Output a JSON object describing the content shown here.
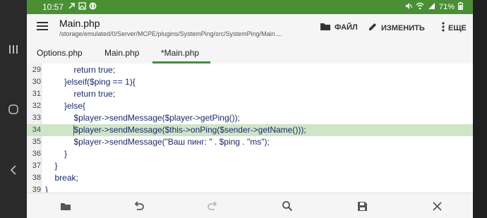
{
  "status": {
    "time": "10:57",
    "battery": "71%",
    "left_icons": [
      "missed-call-icon",
      "image-icon",
      "shazam-icon"
    ],
    "right_icons": [
      "mute-icon",
      "wifi-icon",
      "signal-icon",
      "battery-icon"
    ]
  },
  "toolbar": {
    "title": "Main.php",
    "path": "/storage/emulated/0/Server/MCPE/plugins/SystemPing/src/SystemPing/Main....",
    "file_label": "ФАЙЛ",
    "edit_label": "ИЗМЕНИТЬ",
    "more_label": "ЕЩЕ"
  },
  "tabs": [
    {
      "label": "Options.php",
      "active": false
    },
    {
      "label": "Main.php",
      "active": false
    },
    {
      "label": "*Main.php",
      "active": true
    }
  ],
  "editor": {
    "highlight_color": "#cfe5c8",
    "lines": [
      {
        "n": "29",
        "text": "return true;",
        "indent": 3
      },
      {
        "n": "30",
        "text": "}elseif($ping == 1){",
        "indent": 2
      },
      {
        "n": "31",
        "text": "return true;",
        "indent": 3
      },
      {
        "n": "32",
        "text": "}else{",
        "indent": 2
      },
      {
        "n": "33",
        "text": "$player->sendMessage($player->getPing());",
        "indent": 3
      },
      {
        "n": "34",
        "text": "$player->sendMessage($this->onPing($sender->getName()));",
        "indent": 3,
        "highlight": true
      },
      {
        "n": "35",
        "text": "$player->sendMessage(\"Ваш пинг: \" . $ping . \"ms\");",
        "indent": 3
      },
      {
        "n": "36",
        "text": "}",
        "indent": 2
      },
      {
        "n": "37",
        "text": "}",
        "indent": 1
      },
      {
        "n": "38",
        "text": "break;",
        "indent": 1
      },
      {
        "n": "39",
        "text": "}",
        "indent": 0
      }
    ]
  },
  "bottombar": [
    "open-folder-icon",
    "undo-icon",
    "redo-icon",
    "search-icon",
    "save-icon",
    "close-icon"
  ],
  "colors": {
    "status_green": "#4a8f34",
    "tab_accent": "#3f8f3a"
  }
}
